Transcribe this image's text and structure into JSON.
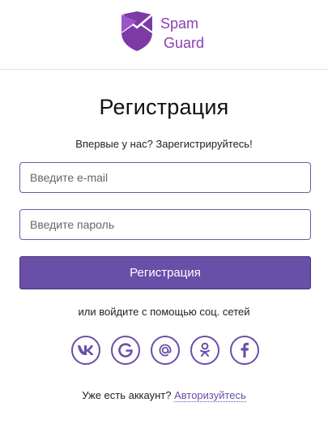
{
  "brand": {
    "line1": "Spam",
    "line2": "Guard",
    "color": "#8a3fb3"
  },
  "form": {
    "title": "Регистрация",
    "subtitle": "Впервые у нас? Зарегистрируйтесь!",
    "email_placeholder": "Введите e-mail",
    "password_placeholder": "Введите пароль",
    "submit_label": "Регистрация"
  },
  "social": {
    "caption": "или войдите с помощью соц. сетей",
    "icons": [
      "vk-icon",
      "google-icon",
      "mail-ru-icon",
      "odnoklassniki-icon",
      "facebook-icon"
    ]
  },
  "footer": {
    "text": "Уже есть аккаунт?",
    "link_label": "Авторизуйтесь"
  },
  "colors": {
    "accent": "#6a4fa8",
    "input_border": "#6a5aa6"
  }
}
